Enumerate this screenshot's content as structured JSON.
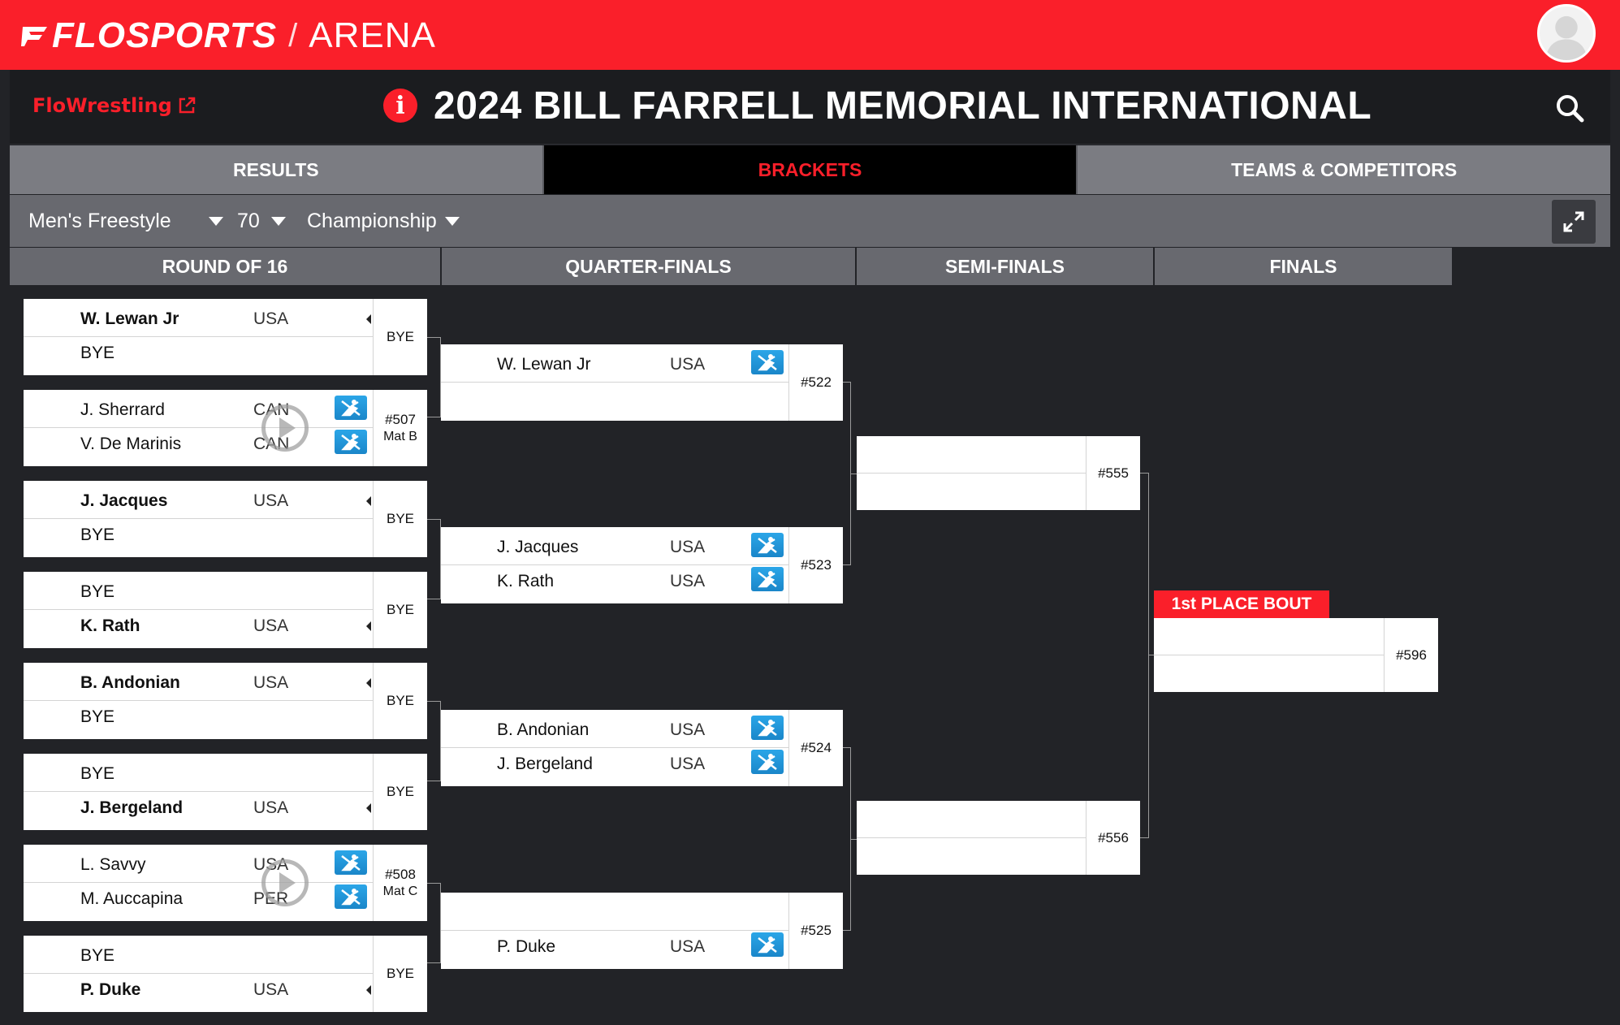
{
  "brand": {
    "flo": "FLOSPORTS",
    "separator": "/",
    "product": "ARENA",
    "accent": "#fa1f2a"
  },
  "header": {
    "flowrestling_link": "FloWrestling",
    "event_title": "2024 BILL FARRELL MEMORIAL INTERNATIONAL"
  },
  "tabs": [
    {
      "label": "RESULTS",
      "active": false
    },
    {
      "label": "BRACKETS",
      "active": true
    },
    {
      "label": "TEAMS & COMPETITORS",
      "active": false
    }
  ],
  "filters": {
    "style": "Men's Freestyle",
    "weight": "70",
    "bracket": "Championship"
  },
  "rounds": [
    "ROUND OF 16",
    "QUARTER-FINALS",
    "SEMI-FINALS",
    "FINALS"
  ],
  "round_of_16": [
    {
      "top": {
        "name": "W. Lewan Jr",
        "country": "USA",
        "winner": true
      },
      "bottom": {
        "name": "BYE",
        "country": "",
        "winner": false
      },
      "bout": "BYE",
      "mat": "",
      "video": false
    },
    {
      "top": {
        "name": "J. Sherrard",
        "country": "CAN",
        "winner": false
      },
      "bottom": {
        "name": "V. De Marinis",
        "country": "CAN",
        "winner": false
      },
      "bout": "#507",
      "mat": "Mat B",
      "video": true
    },
    {
      "top": {
        "name": "J. Jacques",
        "country": "USA",
        "winner": true
      },
      "bottom": {
        "name": "BYE",
        "country": "",
        "winner": false
      },
      "bout": "BYE",
      "mat": "",
      "video": false
    },
    {
      "top": {
        "name": "BYE",
        "country": "",
        "winner": false
      },
      "bottom": {
        "name": "K. Rath",
        "country": "USA",
        "winner": true
      },
      "bout": "BYE",
      "mat": "",
      "video": false
    },
    {
      "top": {
        "name": "B. Andonian",
        "country": "USA",
        "winner": true
      },
      "bottom": {
        "name": "BYE",
        "country": "",
        "winner": false
      },
      "bout": "BYE",
      "mat": "",
      "video": false
    },
    {
      "top": {
        "name": "BYE",
        "country": "",
        "winner": false
      },
      "bottom": {
        "name": "J. Bergeland",
        "country": "USA",
        "winner": true
      },
      "bout": "BYE",
      "mat": "",
      "video": false
    },
    {
      "top": {
        "name": "L. Savvy",
        "country": "USA",
        "winner": false
      },
      "bottom": {
        "name": "M. Auccapina",
        "country": "PER",
        "winner": false
      },
      "bout": "#508",
      "mat": "Mat C",
      "video": true
    },
    {
      "top": {
        "name": "BYE",
        "country": "",
        "winner": false
      },
      "bottom": {
        "name": "P. Duke",
        "country": "USA",
        "winner": true
      },
      "bout": "BYE",
      "mat": "",
      "video": false
    }
  ],
  "quarter_finals": [
    {
      "top": {
        "name": "W. Lewan Jr",
        "country": "USA"
      },
      "bottom": {
        "name": "",
        "country": ""
      },
      "bout": "#522"
    },
    {
      "top": {
        "name": "J. Jacques",
        "country": "USA"
      },
      "bottom": {
        "name": "K. Rath",
        "country": "USA"
      },
      "bout": "#523"
    },
    {
      "top": {
        "name": "B. Andonian",
        "country": "USA"
      },
      "bottom": {
        "name": "J. Bergeland",
        "country": "USA"
      },
      "bout": "#524"
    },
    {
      "top": {
        "name": "",
        "country": ""
      },
      "bottom": {
        "name": "P. Duke",
        "country": "USA"
      },
      "bout": "#525"
    }
  ],
  "semi_finals": [
    {
      "top": {
        "name": "",
        "country": ""
      },
      "bottom": {
        "name": "",
        "country": ""
      },
      "bout": "#555"
    },
    {
      "top": {
        "name": "",
        "country": ""
      },
      "bottom": {
        "name": "",
        "country": ""
      },
      "bout": "#556"
    }
  ],
  "finals": [
    {
      "label": "1st PLACE BOUT",
      "top": {
        "name": "",
        "country": ""
      },
      "bottom": {
        "name": "",
        "country": ""
      },
      "bout": "#596"
    }
  ]
}
